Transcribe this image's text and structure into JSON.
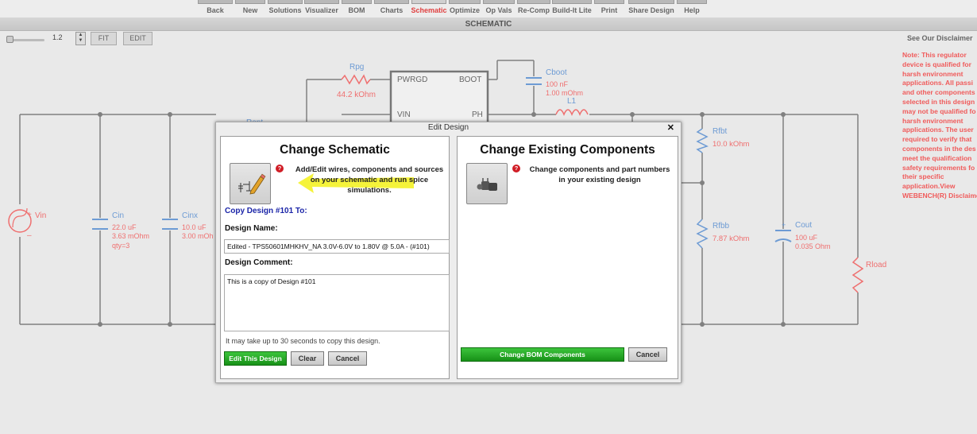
{
  "toolbar": {
    "items": [
      "Back",
      "New",
      "Solutions",
      "Visualizer",
      "BOM",
      "Charts",
      "Schematic",
      "Optimize",
      "Op Vals",
      "Re-Comp",
      "Build-It Lite",
      "Print",
      "Share Design",
      "Help"
    ],
    "active": "Schematic"
  },
  "page_title": "SCHEMATIC",
  "zoom": {
    "value": "1.2",
    "fit_label": "FIT",
    "edit_label": "EDIT"
  },
  "disclaimer_link": "See Our Disclaimer",
  "note_text": "Note: This regulator\ndevice is qualified for\nharsh environment\napplications. All passi\nand other components\nselected in this design\nmay not be qualified fo\nharsh environment\napplications. The user\nrequired to verify that\ncomponents in the des\nmeet the qualification\nsafety requirements fo\ntheir specific\napplication.View\nWEBENCH(R) Disclaime",
  "schematic": {
    "components": {
      "rpg": {
        "name": "Rpg",
        "value": "44.2 kOhm"
      },
      "cboot": {
        "name": "Cboot",
        "value1": "100 nF",
        "value2": "1.00 mOhm"
      },
      "l1": {
        "name": "L1"
      },
      "ic": {
        "pin_pwrgd": "PWRGD",
        "pin_boot": "BOOT",
        "pin_vin": "VIN",
        "pin_ph": "PH"
      },
      "vin": {
        "name": "Vin"
      },
      "cin": {
        "name": "Cin",
        "value1": "22.0 uF",
        "value2": "3.63 mOhm",
        "value3": "qty=3"
      },
      "cinx": {
        "name": "Cinx",
        "value1": "10.0 uF",
        "value2": "3.00 mOh"
      },
      "rent": {
        "name": "Rent"
      },
      "rfbt": {
        "name": "Rfbt",
        "value": "10.0 kOhm"
      },
      "rfbb": {
        "name": "Rfbb",
        "value": "7.87 kOhm"
      },
      "cout": {
        "name": "Cout",
        "value1": "100 uF",
        "value2": "0.035 Ohm"
      },
      "rload": {
        "name": "Rload"
      }
    }
  },
  "dialog": {
    "title": "Edit Design",
    "close_symbol": "✕",
    "left": {
      "heading": "Change Schematic",
      "description_lines": [
        "Add/Edit wires, components and sources",
        "on your schematic and run spice",
        "simulations."
      ],
      "copy_label": "Copy Design #101 To:",
      "design_name_label": "Design Name:",
      "design_name_value": "Edited - TPS50601MHKHV_NA 3.0V-6.0V to 1.80V @ 5.0A - (#101)",
      "design_comment_label": "Design Comment:",
      "design_comment_value": "This is a copy of Design #101",
      "note": "It may take up to 30 seconds to copy this design.",
      "edit_button": "Edit This Design",
      "clear_button": "Clear",
      "cancel_button": "Cancel"
    },
    "right": {
      "heading": "Change Existing Components",
      "description_lines": [
        "Change components and part numbers",
        "in your existing design"
      ],
      "change_bom_button": "Change BOM Components",
      "cancel_button": "Cancel"
    },
    "help_symbol": "?"
  },
  "colors": {
    "wire": "#808080",
    "component": "#6d9bd4",
    "value_text": "#ef6f6f",
    "name_text": "#6d9bd4",
    "highlight": "#f4f22a",
    "accent_green": "#1fa51f"
  }
}
